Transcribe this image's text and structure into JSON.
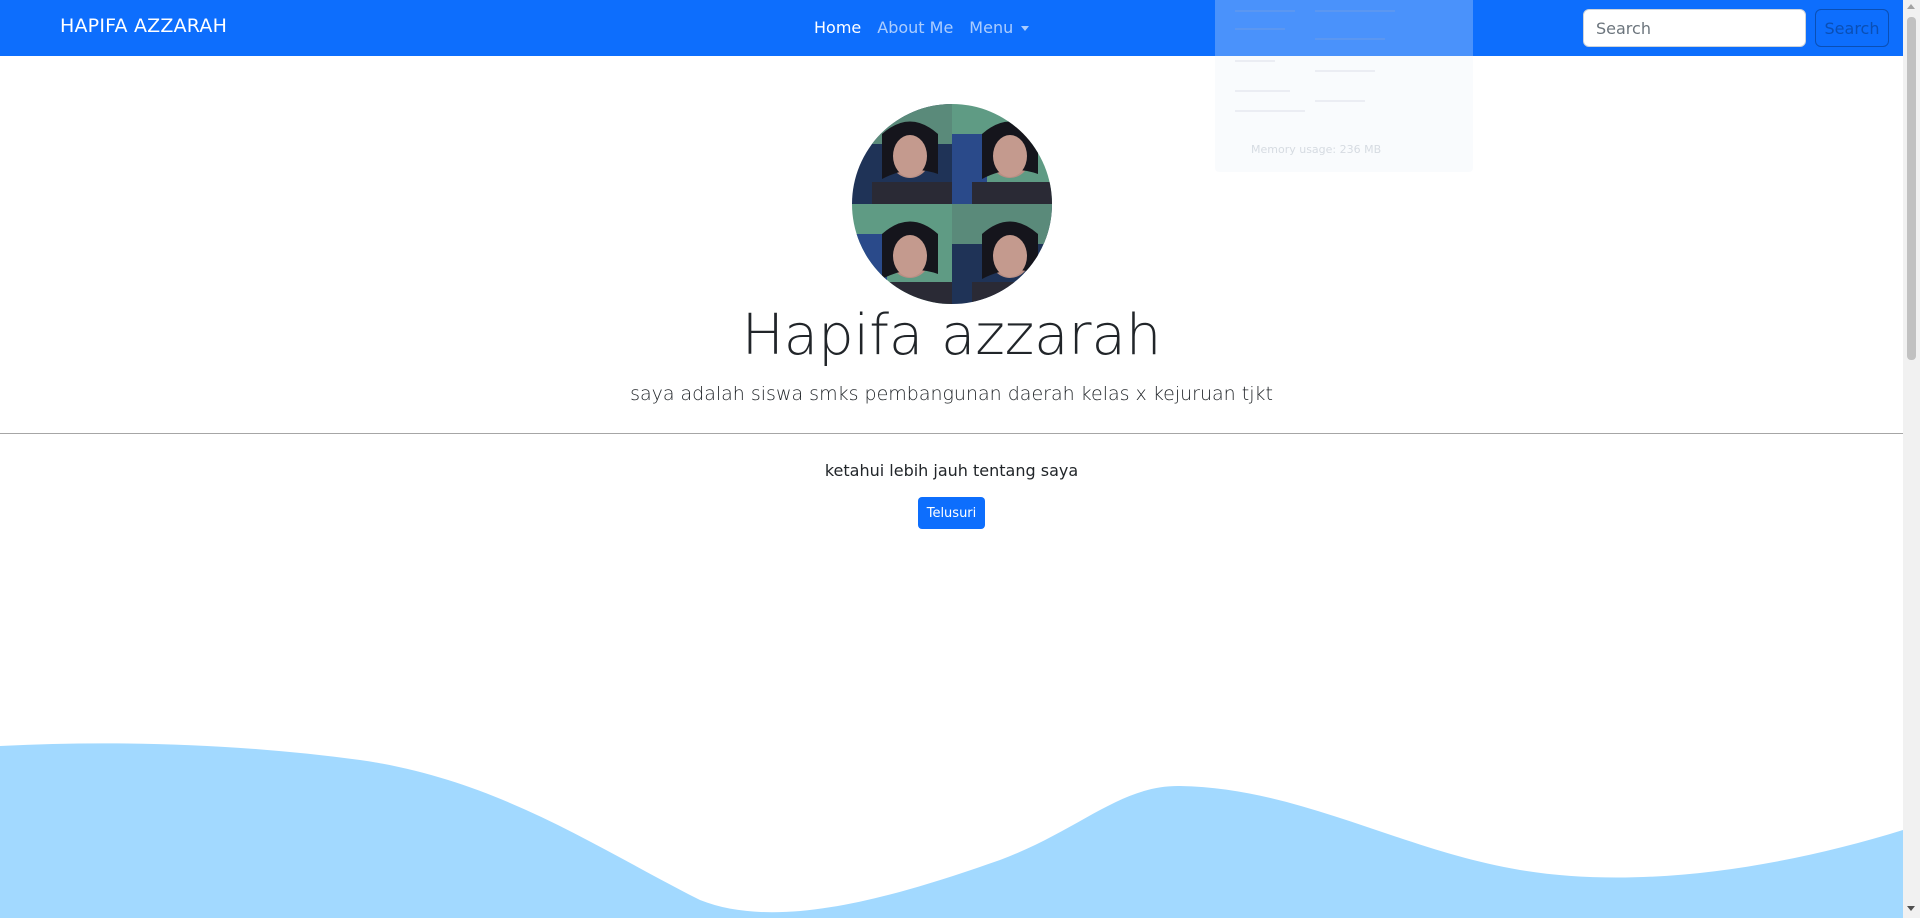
{
  "navbar": {
    "brand": "HAPIFA AZZARAH",
    "links": [
      {
        "label": "Home",
        "active": true
      },
      {
        "label": "About Me",
        "active": false
      },
      {
        "label": "Menu",
        "active": false
      }
    ],
    "search_placeholder": "Search",
    "search_button": "Search"
  },
  "overlay": {
    "memory_text": "Memory usage: 236 MB"
  },
  "profile": {
    "avatar_alt": "profile photo",
    "name": "Hapifa azzarah",
    "description": "saya adalah siswa smks pembangunan daerah kelas x kejuruan tjkt",
    "lead": "ketahui lebih jauh tentang saya",
    "button": "Telusuri"
  },
  "colors": {
    "primary": "#0d6efd",
    "wave": "#a2d9ff"
  }
}
